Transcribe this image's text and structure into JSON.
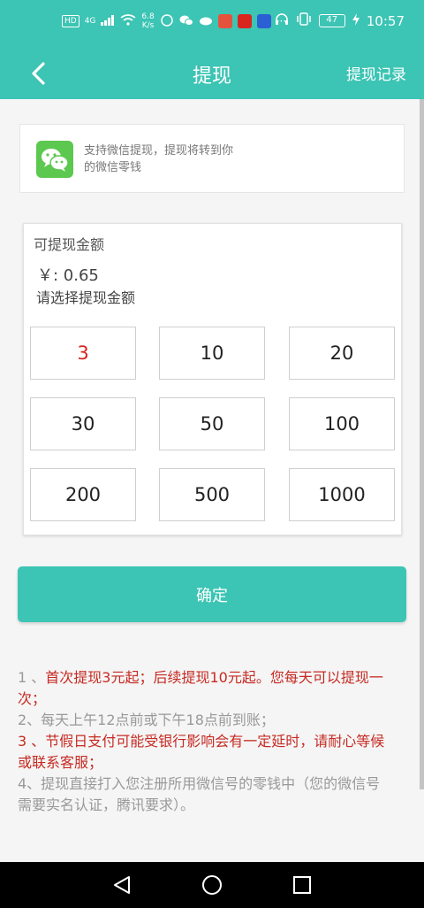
{
  "status_bar": {
    "hd": "HD",
    "network": "4G",
    "speed_value": "6.8",
    "speed_unit": "K/s",
    "battery": "47",
    "time": "10:57",
    "more": "···"
  },
  "header": {
    "title": "提现",
    "records_link": "提现记录"
  },
  "notice": {
    "text": "支持微信提现，提现将转到你的微信零钱"
  },
  "amount_card": {
    "available_label": "可提现金额",
    "balance": "￥: 0.65",
    "choose_label": "请选择提现金额",
    "options": [
      "3",
      "10",
      "20",
      "30",
      "50",
      "100",
      "200",
      "500",
      "1000"
    ],
    "selected": "3"
  },
  "confirm_button": "确定",
  "rules": {
    "r1_num": "1 、",
    "r1_text": "首次提现3元起；后续提现10元起。您每天可以提现一次；",
    "r2": "2、每天上午12点前或下午18点前到账；",
    "r3_num": "3 、",
    "r3_text": "节假日支付可能受银行影响会有一定延时，请耐心等候或联系客服；",
    "r4": "4、提现直接打入您注册所用微信号的零钱中（您的微信号需要实名认证，腾讯要求）。"
  },
  "colors": {
    "accent": "#3cc4b4",
    "selected_text": "#d9251d",
    "rule_red": "#c62a22",
    "wechat_green": "#5cc84f"
  }
}
